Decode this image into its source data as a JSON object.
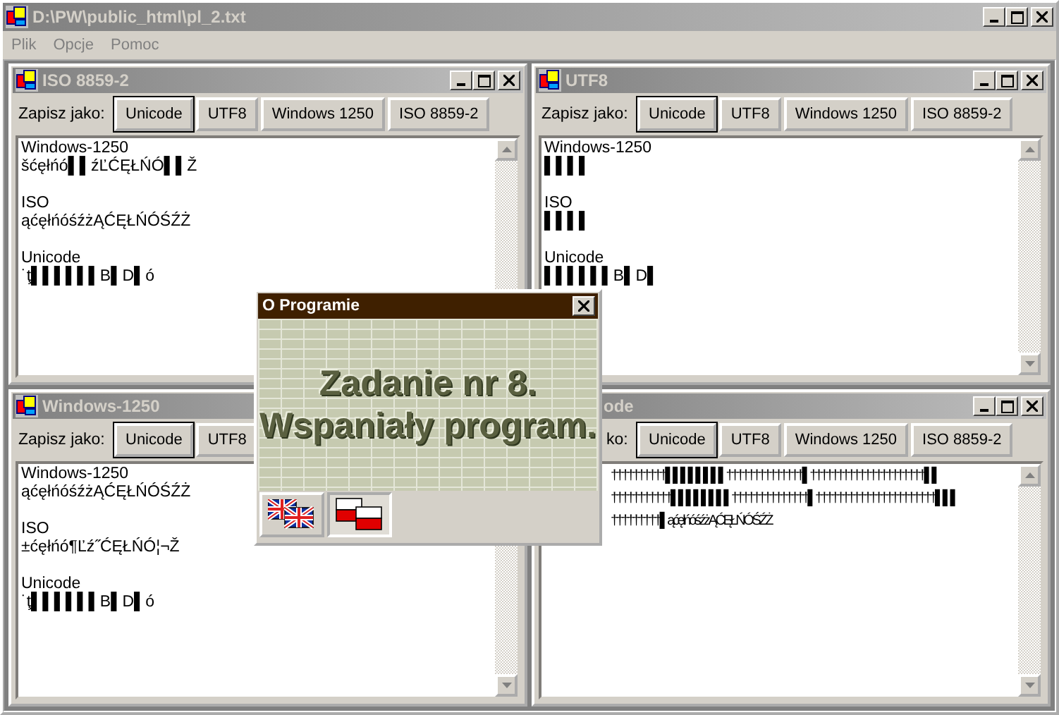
{
  "window": {
    "title": "D:\\PW\\public_html\\pl_2.txt"
  },
  "menu": [
    "Plik",
    "Opcje",
    "Pomoc"
  ],
  "children": [
    {
      "title": "ISO 8859-2",
      "caption_buttons": true,
      "label": "Zapisz jako:",
      "buttons": [
        {
          "label": "Unicode",
          "default": true
        },
        {
          "label": "UTF8",
          "default": false
        },
        {
          "label": "Windows 1250",
          "default": false
        },
        {
          "label": "ISO 8859-2",
          "default": false
        }
      ],
      "blocks": [
        [
          "Windows-1250",
          "šćęłńó▌▌źĽĆĘŁŃÓ▌▌Ž"
        ],
        [
          "ISO",
          "ąćęłńóśźżĄĆĘŁŃÓŚŹŻ"
        ],
        [
          "Unicode",
          "˙ţ▌▌▌▌▌▌B▌D▌ó"
        ]
      ]
    },
    {
      "title": "UTF8",
      "caption_buttons": true,
      "label": "Zapisz jako:",
      "buttons": [
        {
          "label": "Unicode",
          "default": true
        },
        {
          "label": "UTF8",
          "default": false
        },
        {
          "label": "Windows 1250",
          "default": false
        },
        {
          "label": "ISO 8859-2",
          "default": false
        }
      ],
      "blocks": [
        [
          "Windows-1250",
          "▌▌▌▌"
        ],
        [
          "ISO",
          "▌▌▌▌"
        ],
        [
          "Unicode",
          "▌▌▌▌▌▌B▌D▌"
        ]
      ]
    },
    {
      "title": "Windows-1250",
      "caption_buttons": false,
      "label": "Zapisz jako:",
      "buttons": [
        {
          "label": "Unicode",
          "default": true
        },
        {
          "label": "UTF8",
          "default": false
        }
      ],
      "blocks": [
        [
          "Windows-1250",
          "ąćęłńóśźżĄĆĘŁŃÓŚŹŻ"
        ],
        [
          "ISO",
          "±ćęłńó¶Ľź˝ĆĘŁŃÓ¦¬Ž"
        ],
        [
          "Unicode",
          "˙ţ▌▌▌▌▌▌B▌D▌ó"
        ]
      ]
    },
    {
      "title": "ode",
      "caption_buttons": true,
      "label": "ko:",
      "buttons": [
        {
          "label": "Unicode",
          "default": true
        },
        {
          "label": "UTF8",
          "default": false
        },
        {
          "label": "Windows 1250",
          "default": false
        },
        {
          "label": "ISO 8859-2",
          "default": false
        }
      ],
      "blocks": [
        [
          "††††††††††▌▌▌▌▌▌▌▌††††††††††††††▌†††††††††††††††††††††▌▌",
          "†††††††††††▌▌▌▌▌▌▌▌††††††††††††††▌††††††††††††††††††††††▌▌▌",
          "†††††††††▌ąćęłńóśźżĄĆĘŁŃÓŚŹŻ"
        ]
      ]
    }
  ],
  "dialog": {
    "title": "O Programie",
    "heading": [
      "Zadanie nr 8.",
      "Wspaniały program."
    ],
    "languages": [
      {
        "kind": "uk",
        "selected": false
      },
      {
        "kind": "pl",
        "selected": true
      }
    ]
  }
}
